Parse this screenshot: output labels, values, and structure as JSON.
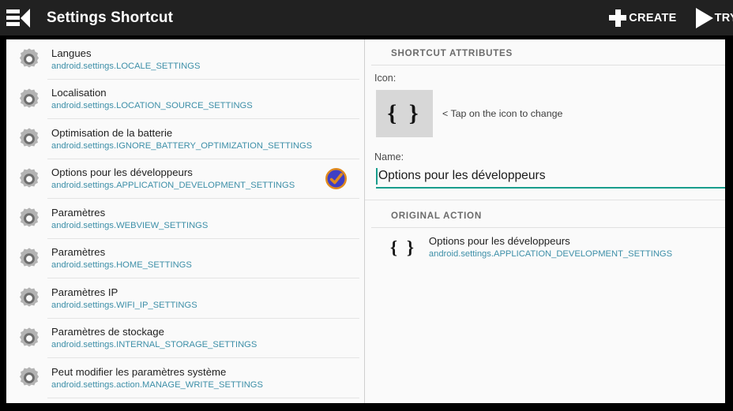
{
  "actionbar": {
    "nav_icon": "list-back-icon",
    "title": "Settings Shortcut",
    "create_label": "CREATE",
    "create_icon": "plus-icon",
    "try_label": "TRY",
    "try_icon": "play-icon"
  },
  "colors": {
    "actionbar_bg": "#212121",
    "window_bg": "#000000",
    "content_bg": "#fafafa",
    "action_uri_text": "#3d8fa8",
    "accent_teal": "#189d8c",
    "badge_fill": "#3f3fc4",
    "badge_ring": "#e08a1e",
    "icon_box_bg": "#d7d7d7"
  },
  "list": {
    "items": [
      {
        "title": "Langues",
        "action": "android.settings.LOCALE_SETTINGS",
        "selected": false
      },
      {
        "title": "Localisation",
        "action": "android.settings.LOCATION_SOURCE_SETTINGS",
        "selected": false
      },
      {
        "title": "Optimisation de la batterie",
        "action": "android.settings.IGNORE_BATTERY_OPTIMIZATION_SETTINGS",
        "selected": false
      },
      {
        "title": "Options pour les développeurs",
        "action": "android.settings.APPLICATION_DEVELOPMENT_SETTINGS",
        "selected": true
      },
      {
        "title": "Paramètres",
        "action": "android.settings.WEBVIEW_SETTINGS",
        "selected": false
      },
      {
        "title": "Paramètres",
        "action": "android.settings.HOME_SETTINGS",
        "selected": false
      },
      {
        "title": "Paramètres IP",
        "action": "android.settings.WIFI_IP_SETTINGS",
        "selected": false
      },
      {
        "title": "Paramètres de stockage",
        "action": "android.settings.INTERNAL_STORAGE_SETTINGS",
        "selected": false
      },
      {
        "title": "Peut modifier les paramètres système",
        "action": "android.settings.action.MANAGE_WRITE_SETTINGS",
        "selected": false
      }
    ]
  },
  "detail": {
    "attributes_header": "SHORTCUT ATTRIBUTES",
    "icon_label": "Icon:",
    "icon_glyph": "{ }",
    "icon_hint": "< Tap on the icon to change",
    "name_label": "Name:",
    "name_value": "Options pour les développeurs",
    "original_header": "ORIGINAL ACTION",
    "original_glyph": "{ }",
    "original_title": "Options pour les développeurs",
    "original_action": "android.settings.APPLICATION_DEVELOPMENT_SETTINGS"
  }
}
